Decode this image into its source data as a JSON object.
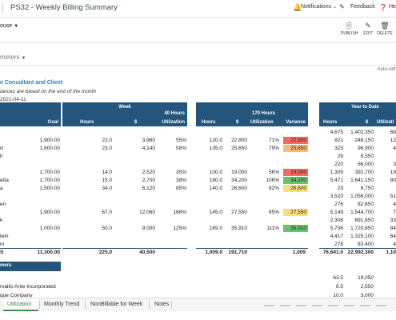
{
  "topbar": {
    "title": "PS32 - Weekly Billing Summary",
    "notifications_label": "Notifications",
    "feedback_label": "Feedback",
    "help_label": "He"
  },
  "location": {
    "label": "ouse"
  },
  "toolbar": {
    "publish_label": "PUBLISH",
    "edit_label": "EDIT",
    "delete_label": "DELETE"
  },
  "parameters": {
    "label": "meters"
  },
  "autorefresh": {
    "label": "Auto-refr"
  },
  "report": {
    "title": "e Consultant and Client",
    "subtitle": "iances are based on the end of the month",
    "date": "2021-04-11"
  },
  "headers": {
    "week": "Week",
    "goal": "Goal",
    "hours": "Hours",
    "dollar": "$",
    "util40_line1": "40 Hours",
    "util40_line2": "Utilization",
    "hours2": "Hours",
    "dollar2": "$",
    "util170_line1": "170 Hours",
    "utilization": "Utilization",
    "variance": "Variance",
    "ytd": "Year to Date",
    "ytd_hours": "Hours",
    "ytd_dollar": "$",
    "ytd_util": "Utilizati"
  },
  "colors": {
    "header_bg": "#24557d",
    "variance_red": "#f46a5f",
    "variance_orange": "#f9b96f",
    "variance_yellow": "#f7e07a",
    "variance_green": "#67c26b",
    "accent_blue": "#2c7fbf",
    "active_tab": "#3b7a3b"
  },
  "rows": [
    {
      "name": "",
      "goal": "",
      "hours": "",
      "dollars": "",
      "util40": "",
      "mhours": "",
      "mdollars": "",
      "mutil": "",
      "variance": "",
      "vcolor": "",
      "yhours": "4,675",
      "ydollars": "1,402,350",
      "yutil": "68"
    },
    {
      "name": "",
      "goal": "1,900.00",
      "hours": "22.0",
      "dollars": "3,960",
      "util40": "55%",
      "mhours": "120.0",
      "mdollars": "22,800",
      "mutil": "71%",
      "variance": "22,800",
      "vcolor": "red",
      "yhours": "821",
      "ydollars": "246,150",
      "yutil": "12"
    },
    {
      "name": "d",
      "goal": "1,600.00",
      "hours": "23.0",
      "dollars": "4,140",
      "util40": "58%",
      "mhours": "135.0",
      "mdollars": "25,650",
      "mutil": "79%",
      "variance": "25,650",
      "vcolor": "orange",
      "yhours": "323",
      "ydollars": "96,900",
      "yutil": "4"
    },
    {
      "name": "ll",
      "goal": "",
      "hours": "",
      "dollars": "",
      "util40": "",
      "mhours": "",
      "mdollars": "",
      "mutil": "",
      "variance": "",
      "vcolor": "",
      "yhours": "29",
      "ydollars": "8,550",
      "yutil": ""
    },
    {
      "name": "",
      "goal": "",
      "hours": "",
      "dollars": "",
      "util40": "",
      "mhours": "",
      "mdollars": "",
      "mutil": "",
      "variance": "",
      "vcolor": "",
      "yhours": "220",
      "ydollars": "66,000",
      "yutil": "3"
    },
    {
      "name": "",
      "goal": "1,700.00",
      "hours": "14.0",
      "dollars": "2,520",
      "util40": "35%",
      "mhours": "100.0",
      "mdollars": "19,000",
      "mutil": "56%",
      "variance": "19,000",
      "vcolor": "red",
      "yhours": "1,309",
      "ydollars": "392,700",
      "yutil": "19"
    },
    {
      "name": "etta",
      "goal": "1,700.00",
      "hours": "15.0",
      "dollars": "2,700",
      "util40": "38%",
      "mhours": "180.0",
      "mdollars": "34,200",
      "mutil": "106%",
      "variance": "34,200",
      "vcolor": "green",
      "yhours": "5,471",
      "ydollars": "1,641,150",
      "yutil": "80"
    },
    {
      "name": "a",
      "goal": "1,500.00",
      "hours": "34.0",
      "dollars": "6,120",
      "util40": "85%",
      "mhours": "140.0",
      "mdollars": "26,600",
      "mutil": "82%",
      "variance": "26,600",
      "vcolor": "yellow",
      "yhours": "23",
      "ydollars": "6,750",
      "yutil": ""
    },
    {
      "name": "",
      "goal": "",
      "hours": "",
      "dollars": "",
      "util40": "",
      "mhours": "",
      "mdollars": "",
      "mutil": "",
      "variance": "",
      "vcolor": "",
      "yhours": "3,520",
      "ydollars": "1,056,000",
      "yutil": "51"
    },
    {
      "name": "en",
      "goal": "",
      "hours": "",
      "dollars": "",
      "util40": "",
      "mhours": "",
      "mdollars": "",
      "mutil": "",
      "variance": "",
      "vcolor": "",
      "yhours": "276",
      "ydollars": "82,650",
      "yutil": "4"
    },
    {
      "name": "",
      "goal": "1,900.00",
      "hours": "67.0",
      "dollars": "12,060",
      "util40": "168%",
      "mhours": "145.0",
      "mdollars": "27,550",
      "mutil": "85%",
      "variance": "27,550",
      "vcolor": "yellow",
      "yhours": "5,149",
      "ydollars": "1,544,700",
      "yutil": "7"
    },
    {
      "name": "k",
      "goal": "",
      "hours": "",
      "dollars": "",
      "util40": "",
      "mhours": "",
      "mdollars": "",
      "mutil": "",
      "variance": "",
      "vcolor": "",
      "yhours": "2,306",
      "ydollars": "691,650",
      "yutil": "33"
    },
    {
      "name": "",
      "goal": "1,000.00",
      "hours": "50.0",
      "dollars": "9,000",
      "util40": "125%",
      "mhours": "189.0",
      "mdollars": "35,910",
      "mutil": "111%",
      "variance": "35,910",
      "vcolor": "green",
      "yhours": "5,736",
      "ydollars": "1,720,650",
      "yutil": "84"
    },
    {
      "name": "tein",
      "goal": "",
      "hours": "",
      "dollars": "",
      "util40": "",
      "mhours": "",
      "mdollars": "",
      "mutil": "",
      "variance": "",
      "vcolor": "",
      "yhours": "4,417",
      "ydollars": "1,325,100",
      "yutil": "64"
    },
    {
      "name": "m",
      "goal": "",
      "hours": "",
      "dollars": "",
      "util40": "",
      "mhours": "",
      "mdollars": "",
      "mutil": "",
      "variance": "",
      "vcolor": "",
      "yhours": "278",
      "ydollars": "83,400",
      "yutil": "4"
    }
  ],
  "totals": {
    "name": "S",
    "goal": "11,300.00",
    "hours": "225.0",
    "dollars": "40,500",
    "mhours": "1,009.0",
    "mdollars": "191,710",
    "variance": "1,009",
    "yhours": "76,641.0",
    "ydollars": "22,992,300",
    "yutil": "1,10"
  },
  "customers_header": "mers",
  "customers": [
    {
      "name": "",
      "hours": "63.5",
      "dollars": "19,050"
    },
    {
      "name": "rvallis Ante Incorporated",
      "hours": "8.5",
      "dollars": "2,550"
    },
    {
      "name": "que Company",
      "hours": "10.0",
      "dollars": "3,000"
    },
    {
      "name": "is Foundation",
      "hours": "3.0",
      "dollars": "900"
    }
  ],
  "tabs": [
    {
      "label": "Utilization",
      "active": true
    },
    {
      "label": "Monthly Trend",
      "active": false
    },
    {
      "label": "NonBillable for Week",
      "active": false
    },
    {
      "label": "Notes",
      "active": false
    }
  ]
}
